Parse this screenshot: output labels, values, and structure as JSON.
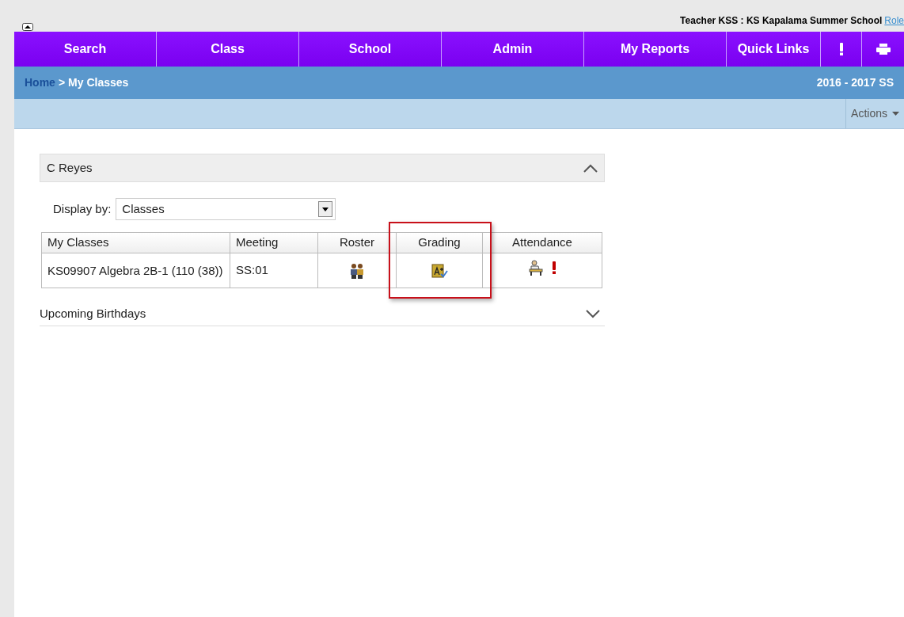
{
  "header": {
    "user": "Teacher KSS : KS Kapalama Summer School",
    "role_link": "Role"
  },
  "nav": [
    "Search",
    "Class",
    "School",
    "Admin",
    "My Reports",
    "Quick Links"
  ],
  "breadcrumb": {
    "home": "Home",
    "separator": ">",
    "current": "My Classes",
    "term": "2016 - 2017 SS"
  },
  "actions": {
    "label": "Actions"
  },
  "panels": [
    {
      "title": "C Reyes",
      "expanded": true,
      "display_by": {
        "label": "Display by:",
        "value": "Classes"
      },
      "table": {
        "columns": [
          {
            "label": "My Classes",
            "highlighted": false
          },
          {
            "label": "Meeting",
            "highlighted": false
          },
          {
            "label": "Roster",
            "highlighted": false
          },
          {
            "label": "Grading",
            "highlighted": true
          },
          {
            "label": "Attendance",
            "highlighted": false
          }
        ],
        "rows": [
          {
            "class": "KS09907 Algebra 2B-1 (110 (38))",
            "meeting": "SS:01",
            "attendance_alert": true
          }
        ]
      }
    },
    {
      "title": "Upcoming Birthdays",
      "expanded": false
    }
  ]
}
